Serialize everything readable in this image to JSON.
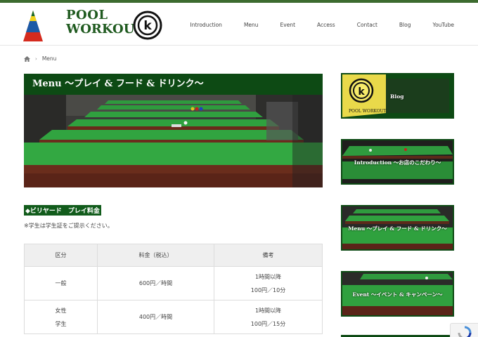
{
  "brand": {
    "line1": "POOL",
    "line2": "WORKOUT",
    "badge_letter": "k"
  },
  "nav": {
    "items": [
      "Introduction",
      "Menu",
      "Event",
      "Access",
      "Contact",
      "Blog",
      "YouTube"
    ]
  },
  "breadcrumb": {
    "current": "Menu"
  },
  "page": {
    "title": "Menu 〜プレイ & フード & ドリンク〜"
  },
  "section": {
    "title": "◆ビリヤード　プレイ料金",
    "note": "※学生は学生証をご提示ください。"
  },
  "price_table": {
    "headers": [
      "区分",
      "料金（税込）",
      "備考"
    ],
    "rows": [
      {
        "category_lines": [
          "一般"
        ],
        "price": "600円／時間",
        "note_lines": [
          "1時間以降",
          "100円／10分"
        ]
      },
      {
        "category_lines": [
          "女性",
          "学生"
        ],
        "price": "400円／時間",
        "note_lines": [
          "1時間以降",
          "100円／15分"
        ]
      }
    ]
  },
  "sidebar": {
    "banners": [
      {
        "label": "Blog",
        "logo_text": "POOL WORKOUT",
        "badge_letter": "k"
      },
      {
        "label": "Introduction 〜お店のこだわり〜"
      },
      {
        "label": "Menu 〜プレイ & フード & ドリンク〜"
      },
      {
        "label": "Event 〜イベント & キャンペーン〜"
      }
    ]
  },
  "colors": {
    "brand_green": "#0d4a14",
    "topbar": "#3c6b2f",
    "felt_green": "#1f9a3a"
  }
}
